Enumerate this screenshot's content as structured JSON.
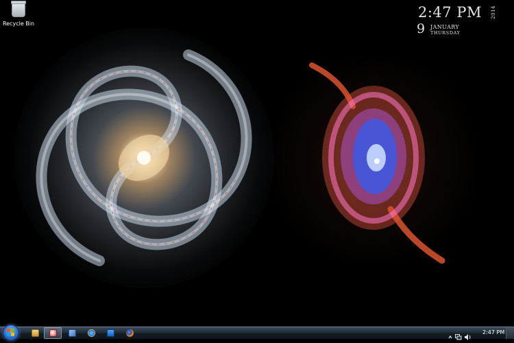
{
  "desktop": {
    "icons": [
      {
        "label": "Recycle Bin",
        "icon": "recycle-bin-icon"
      }
    ]
  },
  "clock_gadget": {
    "time": "2:47 PM",
    "year": "2014",
    "day": "9",
    "month": "JANUARY",
    "weekday": "THURSDAY"
  },
  "taskbar": {
    "start_icon": "windows-logo-icon",
    "pinned": [
      {
        "icon": "windows-explorer-icon"
      },
      {
        "icon": "paint-icon",
        "active": true
      },
      {
        "icon": "control-panel-icon"
      },
      {
        "icon": "internet-explorer-icon"
      },
      {
        "icon": "remote-desktop-icon"
      },
      {
        "icon": "firefox-icon"
      }
    ],
    "tray": {
      "icons": [
        "show-hidden-icons-arrow",
        "network-icon",
        "volume-icon"
      ],
      "time": "2:47 PM"
    }
  },
  "colors": {
    "taskbar_top": "#3c4b5a",
    "taskbar_bottom": "#0f151b",
    "desktop_background": "#000000",
    "clock_text": "#e6e6e6"
  }
}
